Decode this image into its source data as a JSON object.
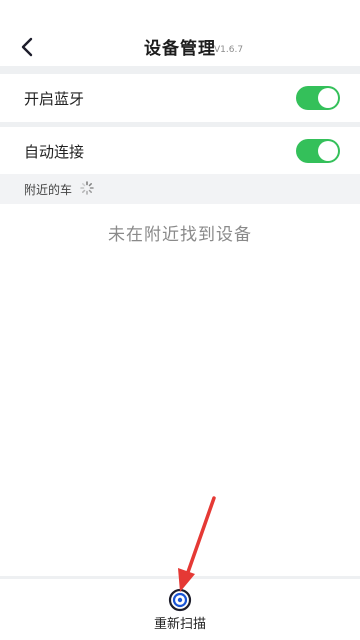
{
  "header": {
    "title": "设备管理",
    "version": "V1.6.7"
  },
  "settings": [
    {
      "label": "开启蓝牙",
      "enabled": true
    },
    {
      "label": "自动连接",
      "enabled": true
    }
  ],
  "nearby": {
    "section_title": "附近的车",
    "empty_message": "未在附近找到设备"
  },
  "footer": {
    "rescan_label": "重新扫描"
  },
  "colors": {
    "toggle_on": "#34c05a",
    "accent_blue": "#1a55d6",
    "annotation_arrow": "#e53935"
  }
}
